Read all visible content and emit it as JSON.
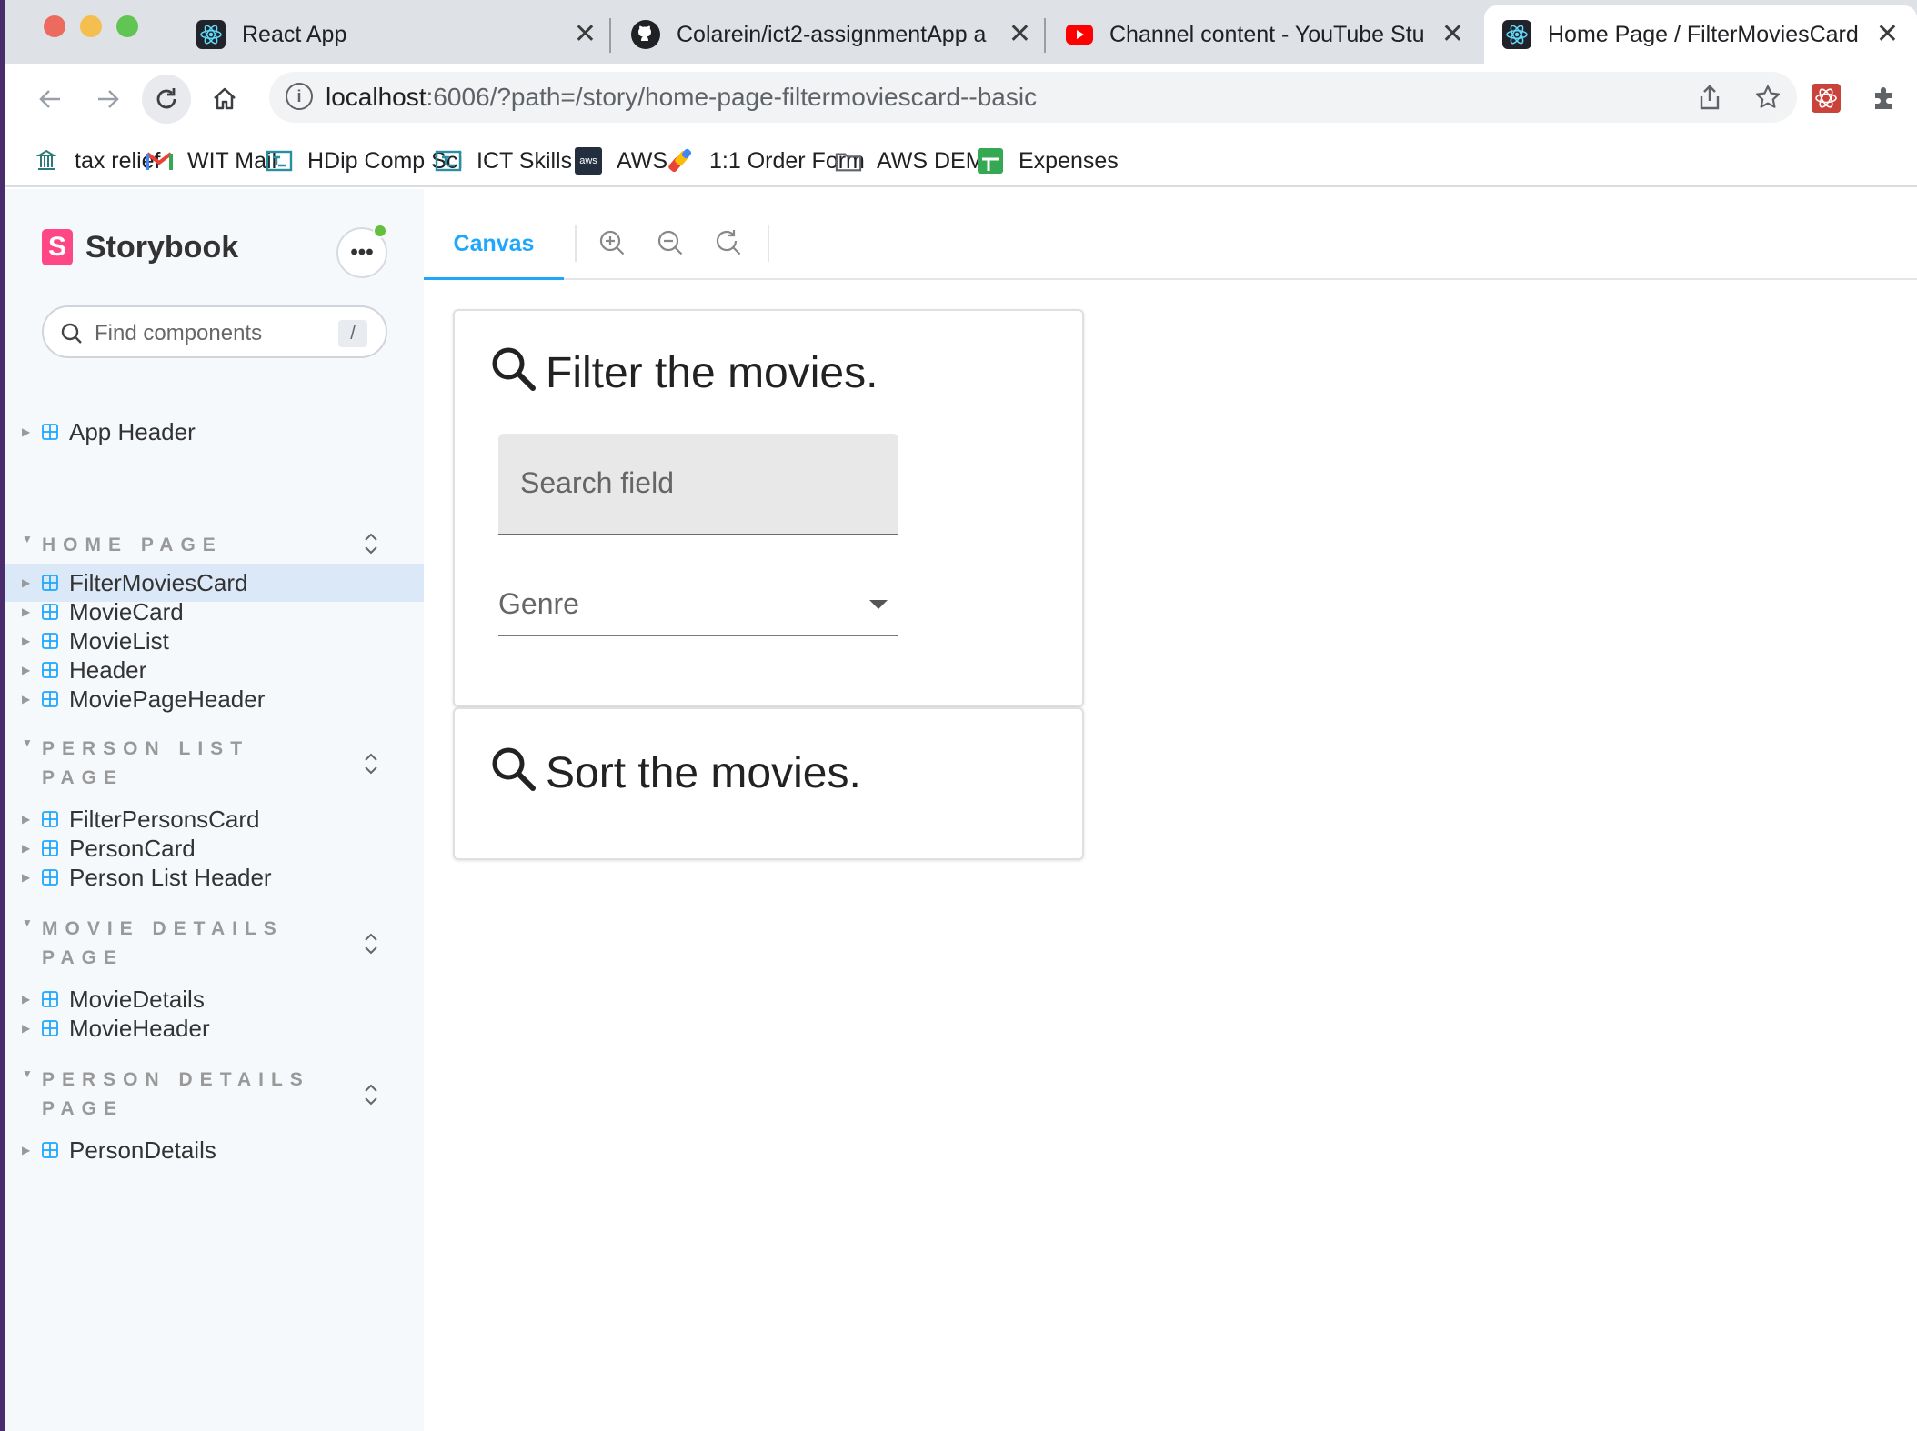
{
  "browser": {
    "tabs": [
      {
        "title": "React App",
        "icon": "react-icon"
      },
      {
        "title": "Colarein/ict2-assignmentApp a",
        "icon": "github-icon"
      },
      {
        "title": "Channel content - YouTube Stu",
        "icon": "youtube-icon"
      },
      {
        "title": "Home Page / FilterMoviesCard",
        "icon": "react-icon"
      }
    ],
    "url_host": "localhost",
    "url_rest": ":6006/?path=/story/home-page-filtermoviescard--basic",
    "bookmarks": [
      {
        "label": "tax relief",
        "icon": "tax-icon"
      },
      {
        "label": "WIT Mail",
        "icon": "gmail-icon"
      },
      {
        "label": "HDip Comp Sci",
        "icon": "teams-icon"
      },
      {
        "label": "ICT Skills 2",
        "icon": "teams-icon"
      },
      {
        "label": "AWS",
        "icon": "aws-icon"
      },
      {
        "label": "1:1 Order Form",
        "icon": "form-icon"
      },
      {
        "label": "AWS DEMO",
        "icon": "folder-icon"
      },
      {
        "label": "Expenses",
        "icon": "sheets-icon"
      }
    ]
  },
  "storybook": {
    "brand": "Storybook",
    "logo_letter": "S",
    "menu_glyph": "•••",
    "search_placeholder": "Find components",
    "search_shortcut": "/",
    "top_items": [
      {
        "label": "App Header"
      }
    ],
    "groups": [
      {
        "label": "HOME PAGE",
        "items": [
          {
            "label": "FilterMoviesCard",
            "active": true
          },
          {
            "label": "MovieCard"
          },
          {
            "label": "MovieList"
          },
          {
            "label": "Header"
          },
          {
            "label": "MoviePageHeader"
          }
        ]
      },
      {
        "label": "PERSON LIST PAGE",
        "items": [
          {
            "label": "FilterPersonsCard"
          },
          {
            "label": "PersonCard"
          },
          {
            "label": "Person List Header"
          }
        ]
      },
      {
        "label": "MOVIE DETAILS PAGE",
        "items": [
          {
            "label": "MovieDetails"
          },
          {
            "label": "MovieHeader"
          }
        ]
      },
      {
        "label": "PERSON DETAILS PAGE",
        "items": [
          {
            "label": "PersonDetails"
          }
        ]
      }
    ],
    "toolbar": {
      "canvas_tab": "Canvas"
    }
  },
  "preview": {
    "filter_card": {
      "title": "Filter the movies.",
      "search_label": "Search field",
      "genre_label": "Genre"
    },
    "sort_card": {
      "title": "Sort the movies."
    }
  },
  "colors": {
    "storybook_accent": "#1ea7fd",
    "storybook_pink": "#ff4785",
    "active_item_bg": "#dbe8f7"
  }
}
